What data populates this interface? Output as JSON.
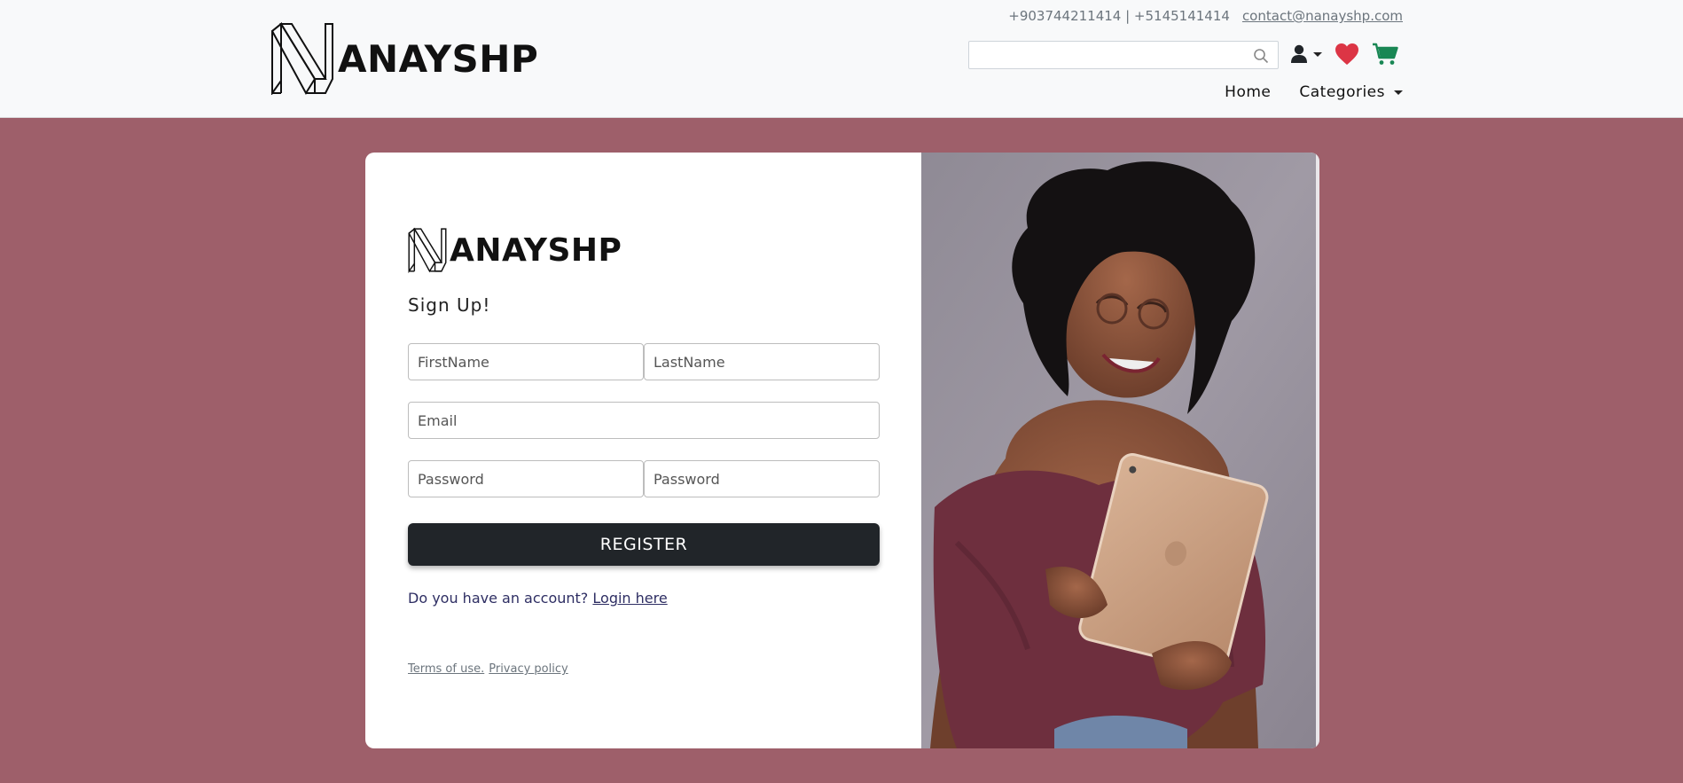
{
  "header": {
    "logo_text": "ANAYSHP",
    "phones": "+903744211414 | +5145141414",
    "email": "contact@nanayshp.com",
    "search": {
      "placeholder": "",
      "value": ""
    },
    "icons": [
      "user-icon",
      "heart-icon",
      "cart-icon"
    ],
    "nav": [
      {
        "label": "Home"
      },
      {
        "label": "Categories"
      }
    ]
  },
  "signup": {
    "logo_text": "ANAYSHP",
    "title": "Sign Up!",
    "fields": {
      "firstname": "FirstName",
      "lastname": "LastName",
      "email": "Email",
      "password": "Password",
      "password_confirm": "Password"
    },
    "register_label": "REGISTER",
    "account_prompt": "Do you have an account?",
    "login_link": "Login here",
    "terms": "Terms of use.",
    "privacy": "Privacy policy"
  },
  "colors": {
    "page_bg": "#9e5f6a",
    "header_bg": "#f8f9fa",
    "button_bg": "#212529",
    "heart": "#dc3545",
    "cart": "#198754",
    "link": "#2e2e63"
  }
}
